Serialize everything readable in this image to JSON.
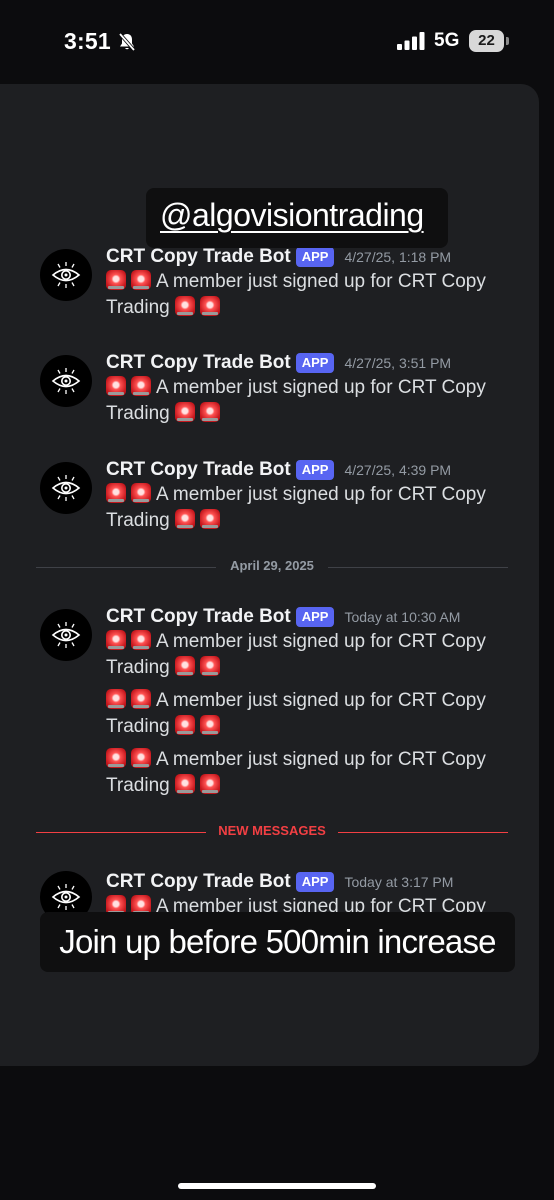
{
  "status_bar": {
    "time": "3:51",
    "network": "5G",
    "battery": "22"
  },
  "chat": {
    "messages": [
      {
        "author": "CRT Copy Trade Bot",
        "badge": "APP",
        "timestamp": "4/27/25, 1:18 PM",
        "lines": [
          "A member just signed up for CRT Copy",
          "Trading"
        ]
      },
      {
        "author": "CRT Copy Trade Bot",
        "badge": "APP",
        "timestamp": "4/27/25, 3:51 PM",
        "lines": [
          "A member just signed up for CRT Copy",
          "Trading"
        ]
      },
      {
        "author": "CRT Copy Trade Bot",
        "badge": "APP",
        "timestamp": "4/27/25, 4:39 PM",
        "lines": [
          "A member just signed up for CRT Copy",
          "Trading"
        ]
      },
      {
        "author": "CRT Copy Trade Bot",
        "badge": "APP",
        "timestamp": "Today at 10:30 AM",
        "lines": [
          "A member just signed up for CRT Copy",
          "Trading",
          "A member just signed up for CRT Copy",
          "Trading",
          "A member just signed up for CRT Copy",
          "Trading"
        ]
      },
      {
        "author": "CRT Copy Trade Bot",
        "badge": "APP",
        "timestamp": "Today at 3:17 PM",
        "lines": [
          "A member just signed up for CRT Copy"
        ]
      }
    ],
    "date_divider": "April 29, 2025",
    "new_divider": "NEW MESSAGES"
  },
  "overlays": {
    "handle": "@algovisiontrading",
    "caption": "Join up before 500min increase"
  },
  "colors": {
    "card_background": "#1e1f22",
    "app_badge": "#5865f2",
    "new_messages": "#f23f43",
    "timestamp": "#949ba4"
  },
  "icons": {
    "avatar": "eye-icon",
    "siren": "police-light-icon",
    "silent": "bell-slash-icon",
    "signal": "cellular-signal-icon",
    "battery": "battery-icon"
  }
}
